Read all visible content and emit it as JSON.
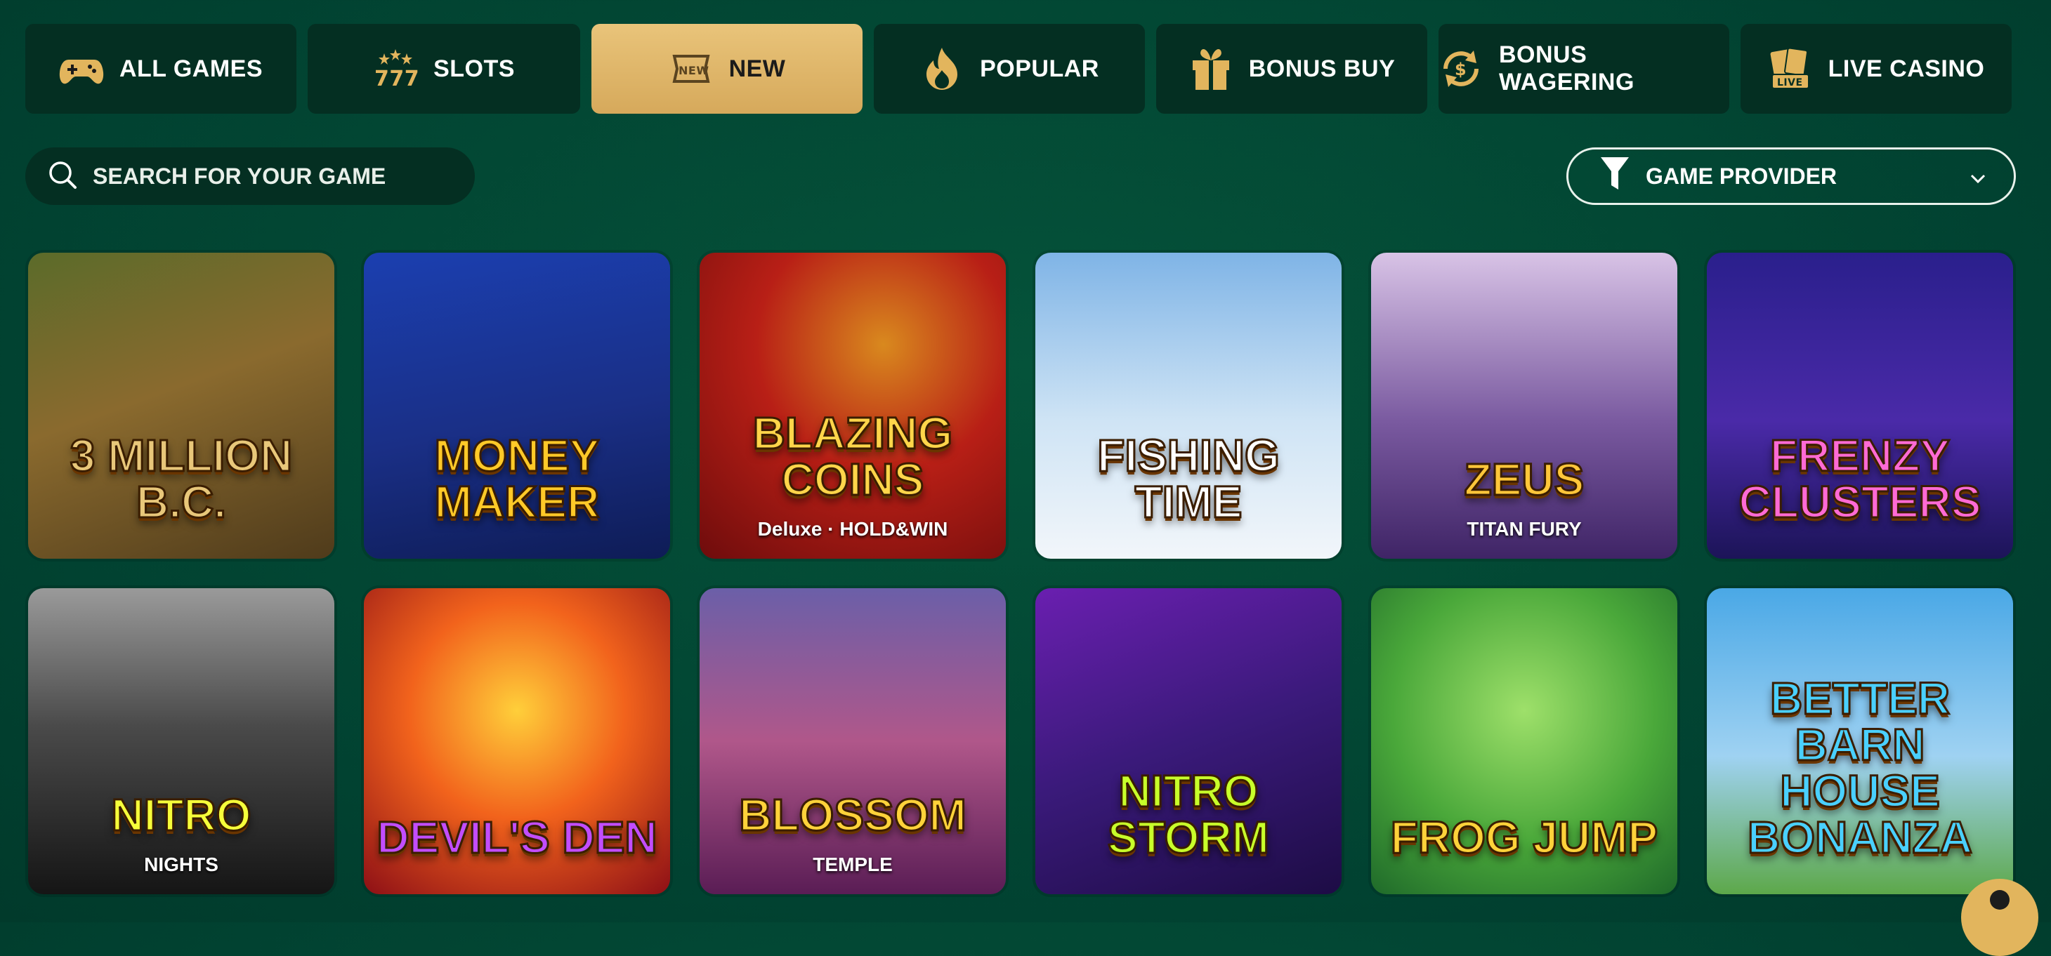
{
  "tabs": [
    {
      "id": "all",
      "label": "ALL GAMES",
      "icon": "gamepad-icon",
      "active": false
    },
    {
      "id": "slots",
      "label": "SLOTS",
      "icon": "slot-777-icon",
      "active": false
    },
    {
      "id": "new",
      "label": "NEW",
      "icon": "new-badge-icon",
      "active": true
    },
    {
      "id": "popular",
      "label": "POPULAR",
      "icon": "flame-icon",
      "active": false
    },
    {
      "id": "bonus_buy",
      "label": "BONUS BUY",
      "icon": "gift-icon",
      "active": false
    },
    {
      "id": "bonus_wagering",
      "label": "BONUS WAGERING",
      "icon": "dollar-cycle-icon",
      "active": false
    },
    {
      "id": "live_casino",
      "label": "LIVE CASINO",
      "icon": "live-cards-icon",
      "active": false
    }
  ],
  "search": {
    "placeholder": "SEARCH FOR YOUR GAME",
    "value": ""
  },
  "provider": {
    "label": "GAME PROVIDER"
  },
  "games": [
    {
      "title": "3 MILLION B.C.",
      "sub": "",
      "bg": "linear-gradient(160deg,#5b6b2a 0%,#8a6a2e 45%,#4f3b1b 100%)",
      "color": "#e8c77a"
    },
    {
      "title": "MONEY MAKER",
      "sub": "",
      "bg": "linear-gradient(170deg,#1b3fb0 0%,#1a2f86 55%,#0e1c56 100%)",
      "color": "#ffc928"
    },
    {
      "title": "BLAZING COINS",
      "sub": "Deluxe · HOLD&WIN",
      "bg": "radial-gradient(circle at 60% 30%,#d9891e 0%,#b81f16 45%,#6e0c0c 100%)",
      "color": "#ffd54a"
    },
    {
      "title": "FISHING TIME",
      "sub": "",
      "bg": "linear-gradient(180deg,#7fb4e6 0%,#cfe4f5 55%,#f2f6fa 100%)",
      "color": "#ffffff"
    },
    {
      "title": "ZEUS",
      "sub": "TITAN FURY",
      "bg": "linear-gradient(180deg,#d8c3e6 0%,#7a5aa0 55%,#3f2466 100%)",
      "color": "#ffc63a"
    },
    {
      "title": "FRENZY CLUSTERS",
      "sub": "",
      "bg": "linear-gradient(180deg,#2a1f8c 0%,#4a2aa8 55%,#1c1458 100%)",
      "color": "#ff6ad5"
    },
    {
      "title": "NITRO",
      "sub": "NIGHTS",
      "bg": "linear-gradient(180deg,#9a9a9a 0%,#4a4a4a 45%,#151515 100%)",
      "color": "#f6ff3a"
    },
    {
      "title": "DEVIL'S DEN",
      "sub": "",
      "bg": "radial-gradient(circle at 50% 40%,#ffcf3a 0%,#f2631c 45%,#8d0f16 100%)",
      "color": "#c24dff"
    },
    {
      "title": "BLOSSOM",
      "sub": "TEMPLE",
      "bg": "linear-gradient(180deg,#6b5fa8 0%,#b0578a 50%,#5a1d55 100%)",
      "color": "#ffd23a"
    },
    {
      "title": "NITRO STORM",
      "sub": "",
      "bg": "linear-gradient(160deg,#6a1fb0 0%,#3a1a7a 50%,#1d0c45 100%)",
      "color": "#c8ff2a"
    },
    {
      "title": "FROG JUMP",
      "sub": "",
      "bg": "radial-gradient(circle at 50% 40%,#9ee06a 0%,#4aa83a 55%,#1f6a2a 100%)",
      "color": "#ffd23a"
    },
    {
      "title": "BETTER BARN HOUSE BONANZA",
      "sub": "",
      "bg": "linear-gradient(180deg,#4aa8e6 0%,#9fd2f2 55%,#5da84a 100%)",
      "color": "#4ad0ff"
    }
  ],
  "fab": {
    "icon": "support-icon"
  }
}
